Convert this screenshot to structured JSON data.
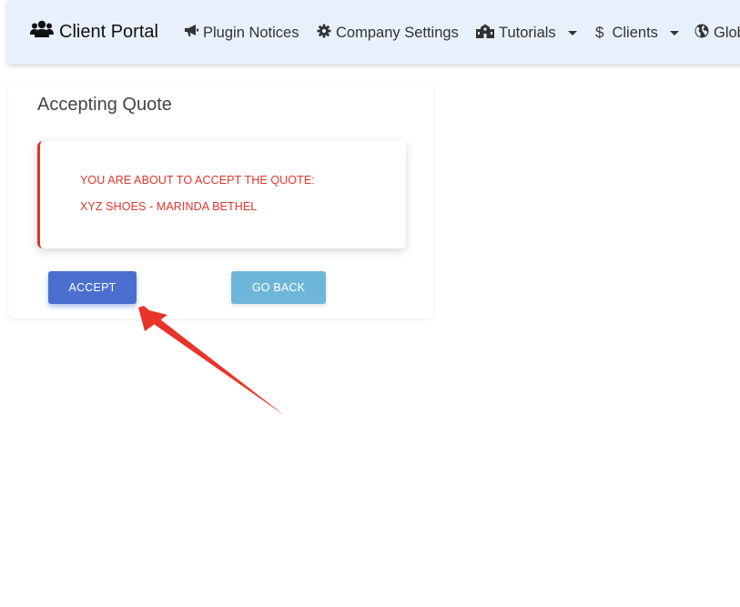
{
  "navbar": {
    "brand": "Client Portal",
    "items": [
      {
        "label": "Plugin Notices",
        "icon": "bullhorn-icon"
      },
      {
        "label": "Company Settings",
        "icon": "gear-icon"
      },
      {
        "label": "Tutorials",
        "icon": "school-icon",
        "dropdown": true
      },
      {
        "label": "Clients",
        "icon": "dollar-icon",
        "dropdown": true
      },
      {
        "label": "Glob",
        "icon": "globe-icon"
      }
    ]
  },
  "card": {
    "title": "Accepting Quote",
    "alert_line1": "YOU ARE ABOUT TO ACCEPT THE QUOTE:",
    "alert_line2": "XYZ SHOES - MARINDA BETHEL",
    "accept_label": "ACCEPT",
    "back_label": "GO BACK"
  },
  "colors": {
    "navbar_bg": "#e8f1fb",
    "alert_accent": "#e0342b",
    "accept_button": "#4a6fcf",
    "back_button": "#6eb6d9",
    "annotation_arrow": "#e8342a"
  }
}
